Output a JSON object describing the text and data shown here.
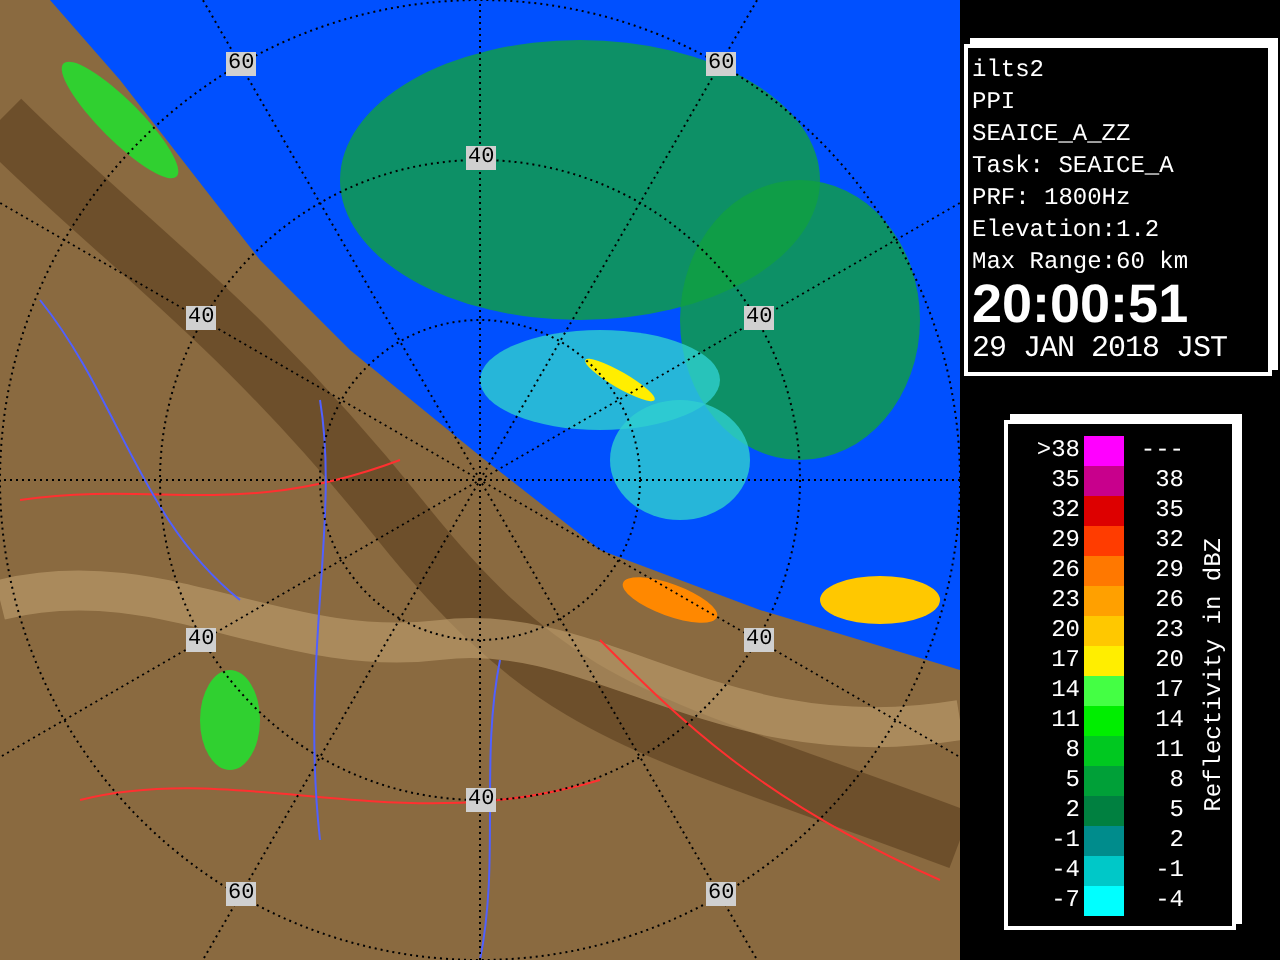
{
  "map": {
    "range_labels": [
      "60",
      "60",
      "40",
      "40",
      "40",
      "40",
      "40",
      "40",
      "60",
      "60"
    ]
  },
  "info": {
    "lines": [
      "ilts2",
      "PPI",
      "SEAICE_A_ZZ",
      "Task: SEAICE_A",
      "PRF: 1800Hz",
      "Elevation:1.2",
      "Max Range:60 km"
    ],
    "time": "20:00:51",
    "date": "29 JAN 2018 JST"
  },
  "legend": {
    "title": "Reflectivity in dBZ",
    "rows": [
      {
        "low": ">38",
        "high": "---",
        "color": "#ff00ff"
      },
      {
        "low": "35",
        "high": "38",
        "color": "#c8008c"
      },
      {
        "low": "32",
        "high": "35",
        "color": "#dd0000"
      },
      {
        "low": "29",
        "high": "32",
        "color": "#ff3c00"
      },
      {
        "low": "26",
        "high": "29",
        "color": "#ff7800"
      },
      {
        "low": "23",
        "high": "26",
        "color": "#ffa000"
      },
      {
        "low": "20",
        "high": "23",
        "color": "#ffc800"
      },
      {
        "low": "17",
        "high": "20",
        "color": "#ffee00"
      },
      {
        "low": "14",
        "high": "17",
        "color": "#44ff44"
      },
      {
        "low": "11",
        "high": "14",
        "color": "#00ee00"
      },
      {
        "low": "8",
        "high": "11",
        "color": "#00c820"
      },
      {
        "low": "5",
        "high": "8",
        "color": "#00a038"
      },
      {
        "low": "2",
        "high": "5",
        "color": "#008040"
      },
      {
        "low": "-1",
        "high": "2",
        "color": "#008c8c"
      },
      {
        "low": "-4",
        "high": "-1",
        "color": "#00c8c8"
      },
      {
        "low": "-7",
        "high": "-4",
        "color": "#00ffff"
      }
    ]
  }
}
